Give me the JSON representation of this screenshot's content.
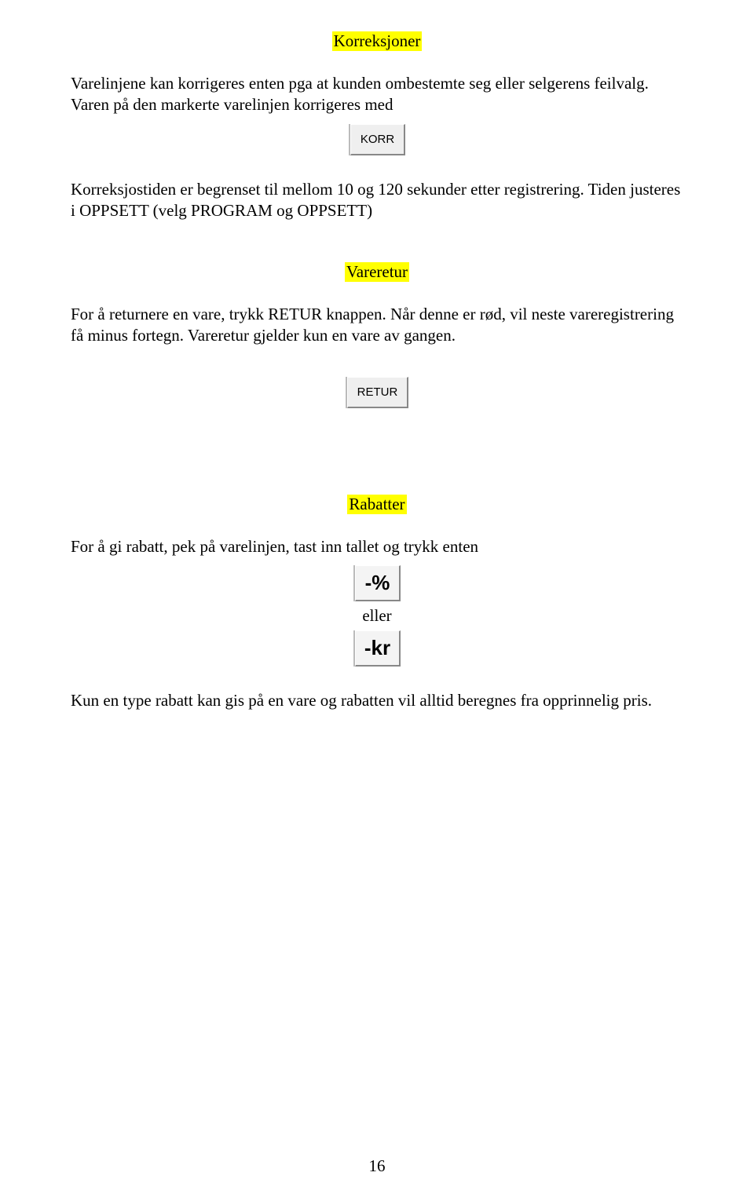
{
  "sections": {
    "korreksjoner": {
      "title": "Korreksjoner",
      "p1": "Varelinjene kan korrigeres enten pga at kunden ombestemte seg eller selgerens feilvalg. Varen på den markerte varelinjen korrigeres med",
      "button": "KORR",
      "p2": "Korreksjostiden er begrenset til mellom 10 og 120 sekunder etter registrering. Tiden justeres i OPPSETT  (velg PROGRAM og OPPSETT)"
    },
    "vareretur": {
      "title": "Vareretur",
      "p1": "For å returnere en vare, trykk RETUR knappen. Når denne er rød, vil neste vareregistrering få minus fortegn.  Vareretur gjelder kun en vare av gangen.",
      "button": "RETUR"
    },
    "rabatter": {
      "title": "Rabatter",
      "p1": "For å gi rabatt, pek på varelinjen, tast inn tallet og trykk enten",
      "button_pct": "-%",
      "eller": "eller",
      "button_kr": "-kr",
      "p2": "Kun en type rabatt kan gis på en vare og rabatten vil alltid beregnes fra opprinnelig pris."
    }
  },
  "page_number": "16"
}
